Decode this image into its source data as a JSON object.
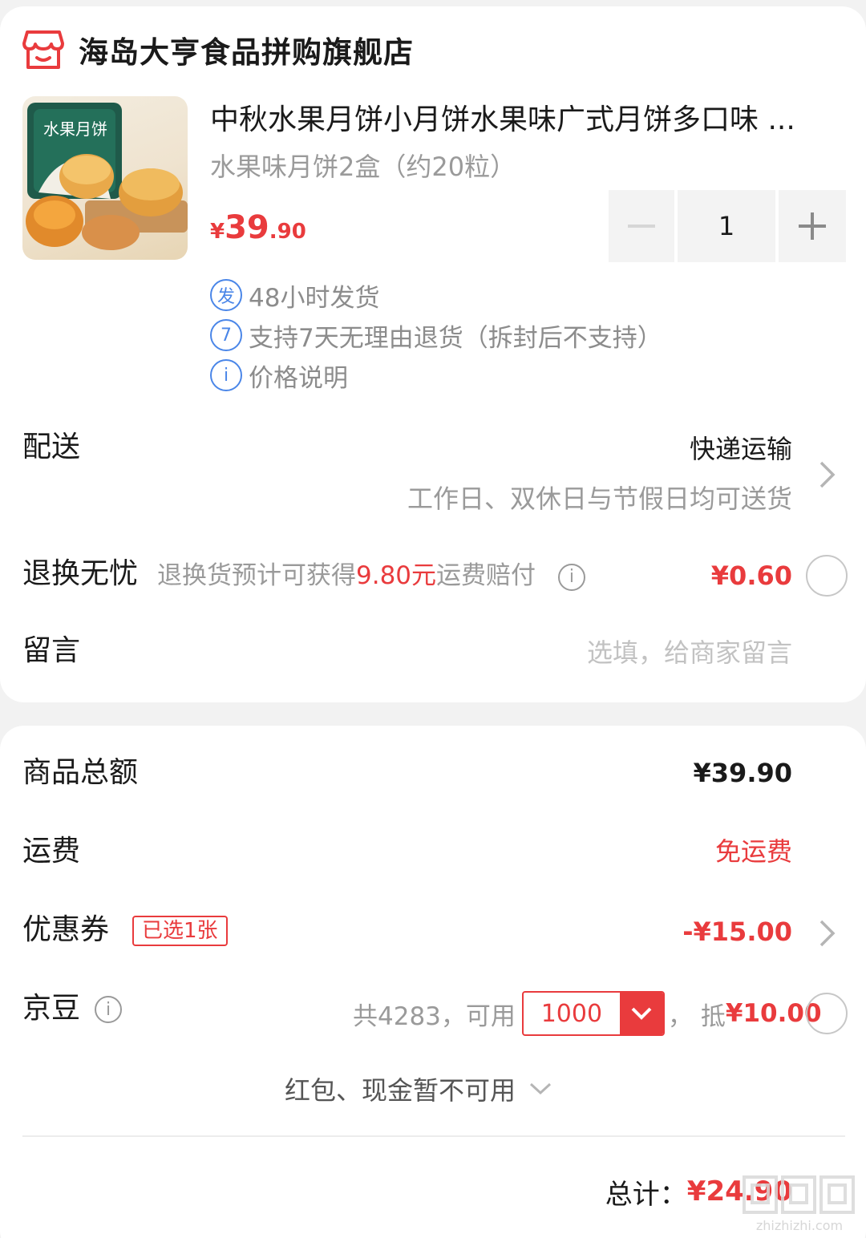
{
  "colors": {
    "accent": "#e93b3d",
    "service_icon": "#4a86e8"
  },
  "shop": {
    "name": "海岛大亨食品拼购旗舰店",
    "icon": "store-icon"
  },
  "product": {
    "title": "中秋水果月饼小月饼水果味广式月饼多口味 ...",
    "spec": "水果味月饼2盒（约20粒）",
    "image_label": "水果月饼",
    "price_currency": "¥",
    "price_int": "39",
    "price_dec": ".90",
    "quantity": "1"
  },
  "services": [
    {
      "icon": "发",
      "text": "48小时发货"
    },
    {
      "icon": "7",
      "text": "支持7天无理由退货（拆封后不支持）"
    },
    {
      "icon": "i",
      "text": "价格说明"
    }
  ],
  "delivery": {
    "label": "配送",
    "method": "快递运输",
    "desc": "工作日、双休日与节假日均可送货"
  },
  "return_service": {
    "label": "退换无忧",
    "desc_prefix": "退换货预计可获得",
    "desc_amount": "9.80元",
    "desc_suffix": "运费赔付",
    "price": "¥0.60"
  },
  "message": {
    "label": "留言",
    "placeholder": "选填，给商家留言"
  },
  "summary": {
    "goods_label": "商品总额",
    "goods_value": "¥39.90",
    "shipping_label": "运费",
    "shipping_value": "免运费",
    "coupon_label": "优惠券",
    "coupon_tag": "已选1张",
    "coupon_value": "-¥15.00",
    "beans_label": "京豆",
    "beans_prefix": "共4283，可用",
    "beans_selected": "1000",
    "beans_sep": "，",
    "beans_deduct_prefix": "抵",
    "beans_deduct_value": "¥10.00",
    "redpacket_text": "红包、现金暂不可用",
    "total_label": "总计：",
    "total_value": "¥24.90"
  },
  "watermark": {
    "text": "zhizhizhi.com"
  }
}
